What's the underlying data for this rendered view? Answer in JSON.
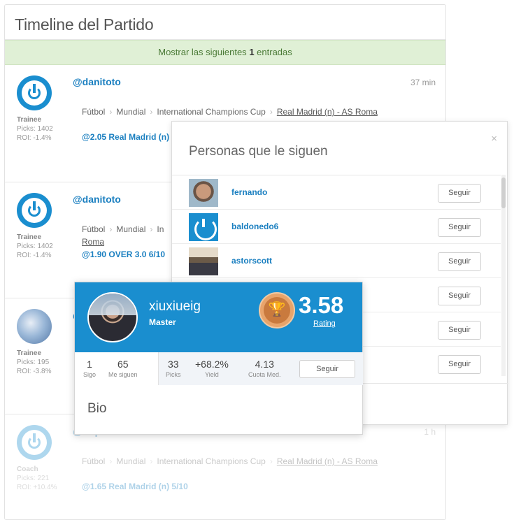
{
  "timeline": {
    "title": "Timeline del Partido",
    "banner_prefix": "Mostrar las siguientes",
    "banner_count": "1",
    "banner_suffix": "entradas"
  },
  "posts": [
    {
      "user": "@danitoto",
      "time": "37 min",
      "rank": "Trainee",
      "picks": "Picks: 1402",
      "roi": "ROI: -1.4%",
      "crumbs": [
        "Fútbol",
        "Mundial",
        "International Champions Cup"
      ],
      "match": "Real Madrid (n) - AS Roma",
      "pick": "@2.05 Real Madrid (n)"
    },
    {
      "user": "@danitoto",
      "time": "",
      "rank": "Trainee",
      "picks": "Picks: 1402",
      "roi": "ROI: -1.4%",
      "crumbs": [
        "Fútbol",
        "Mundial",
        "In"
      ],
      "match": "Roma",
      "pick": "@1.90 OVER 3.0  6/10"
    },
    {
      "user": "@",
      "time": "",
      "rank": "Trainee",
      "picks": "Picks: 195",
      "roi": "ROI: -3.8%"
    },
    {
      "user": "@arqui",
      "time": "1 h",
      "rank": "Coach",
      "picks": "Picks: 221",
      "roi": "ROI: +10.4%",
      "crumbs": [
        "Fútbol",
        "Mundial",
        "International Champions Cup"
      ],
      "match": "Real Madrid (n) - AS Roma",
      "pick": "@1.65 Real Madrid (n)  5/10"
    }
  ],
  "modal": {
    "title": "Personas que le siguen",
    "close": "×",
    "followers": [
      {
        "name": "fernando",
        "button": "Seguir",
        "pic": "face"
      },
      {
        "name": "baldonedo6",
        "button": "Seguir",
        "pic": "logo"
      },
      {
        "name": "astorscott",
        "button": "Seguir",
        "pic": "room"
      },
      {
        "name": "",
        "button": "Seguir",
        "pic": "blue"
      },
      {
        "name": "",
        "button": "Seguir",
        "pic": "none"
      },
      {
        "name": "",
        "button": "Seguir",
        "pic": "none"
      }
    ]
  },
  "profile": {
    "name": "xiuxiueig",
    "rank": "Master",
    "rating_value": "3.58",
    "rating_label": "Rating",
    "trophy_icon": "🏆",
    "stats": {
      "sigo_value": "1",
      "sigo_label": "Sigo",
      "siguen_value": "65",
      "siguen_label": "Me siguen",
      "picks_value": "33",
      "picks_label": "Picks",
      "yield_value": "+68.2%",
      "yield_label": "Yield",
      "cuota_value": "4.13",
      "cuota_label": "Cuota Med."
    },
    "follow_button": "Seguir",
    "bio_title": "Bio"
  },
  "colors": {
    "brand_blue": "#1a8ecf",
    "banner_green": "#e0f0d6",
    "trophy_orange": "#c97a3e"
  }
}
